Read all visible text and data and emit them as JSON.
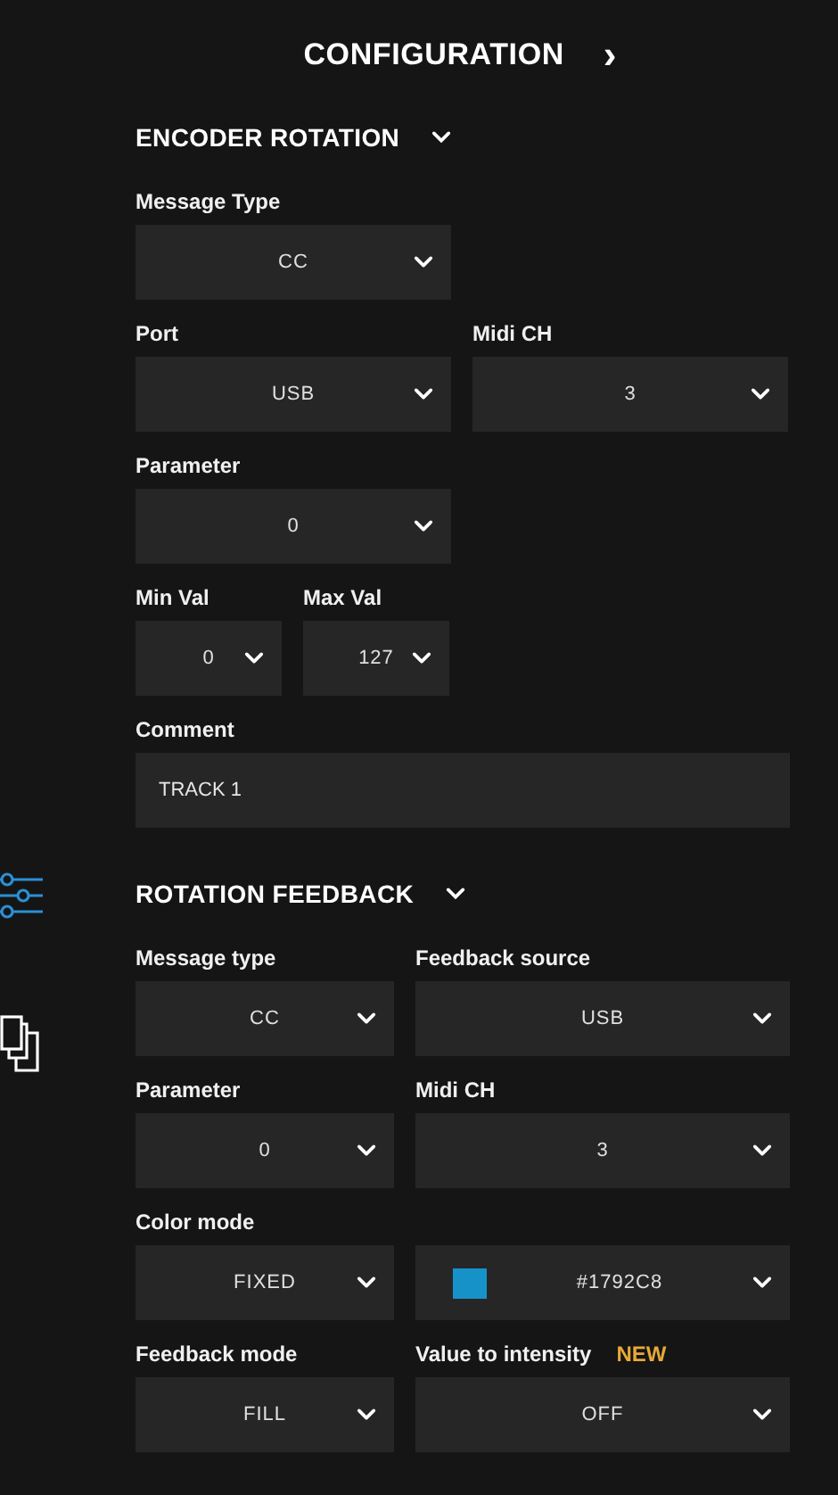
{
  "header": {
    "title": "CONFIGURATION",
    "arrow": "›"
  },
  "sidebar": {
    "items": [
      {
        "kind": "sliders",
        "selected": true
      },
      {
        "kind": "copy",
        "selected": false
      }
    ]
  },
  "sections": [
    {
      "title": "ENCODER ROTATION",
      "expanded": true,
      "rows": [
        [
          {
            "label": "Message Type",
            "kind": "select",
            "value": "CC"
          }
        ],
        [
          {
            "label": "Port",
            "kind": "select",
            "value": "USB"
          },
          {
            "label": "Midi CH",
            "kind": "select",
            "value": "3"
          }
        ],
        [
          {
            "label": "Parameter",
            "kind": "select",
            "value": "0"
          }
        ],
        [
          {
            "label": "Min Val",
            "kind": "select",
            "value": "0"
          },
          {
            "label": "Max Val",
            "kind": "select",
            "value": "127"
          }
        ],
        [
          {
            "label": "Comment",
            "kind": "text",
            "value": "TRACK 1"
          }
        ]
      ]
    },
    {
      "title": "ROTATION FEEDBACK",
      "expanded": true,
      "rows": [
        [
          {
            "label": "Message type",
            "kind": "select",
            "value": "CC"
          },
          {
            "label": "Feedback source",
            "kind": "select",
            "value": "USB"
          }
        ],
        [
          {
            "label": "Parameter",
            "kind": "select",
            "value": "0"
          },
          {
            "label": "Midi CH",
            "kind": "select",
            "value": "3"
          }
        ],
        [
          {
            "label": "Color mode",
            "kind": "select",
            "value": "FIXED"
          },
          {
            "kind": "color",
            "value": "#1792C8",
            "color": "#1792c8"
          }
        ],
        [
          {
            "label": "Feedback mode",
            "kind": "select",
            "value": "FILL"
          },
          {
            "label": "Value to intensity",
            "badge": "NEW",
            "kind": "select",
            "value": "OFF"
          }
        ]
      ]
    }
  ]
}
